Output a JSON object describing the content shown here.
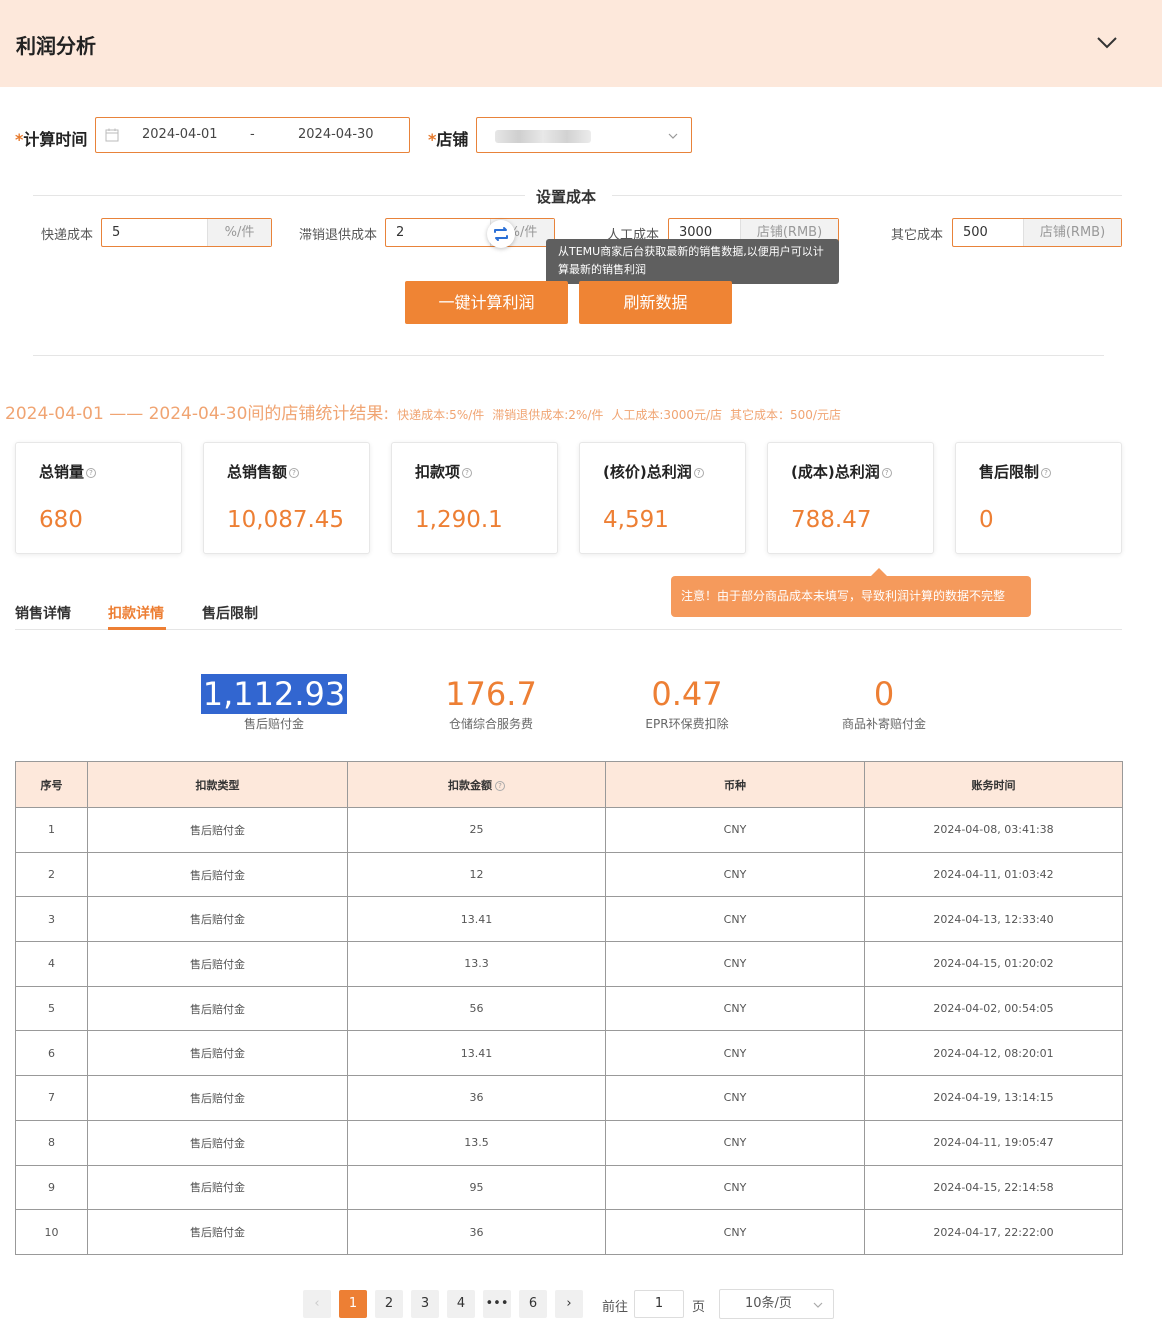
{
  "header": {
    "title": "利润分析"
  },
  "filters": {
    "time_label": "计算时间",
    "required_mark": "*",
    "date_start": "2024-04-01",
    "date_sep": "-",
    "date_end": "2024-04-30",
    "shop_label": "店铺"
  },
  "cost_settings": {
    "title": "设置成本",
    "express": {
      "label": "快递成本",
      "value": "5",
      "unit": "%/件"
    },
    "unsold": {
      "label": "滞销退供成本",
      "value": "2",
      "unit": "%/件"
    },
    "labor": {
      "label": "人工成本",
      "value": "3000",
      "unit": "店铺(RMB)"
    },
    "other": {
      "label": "其它成本",
      "value": "500",
      "unit": "店铺(RMB)"
    }
  },
  "tooltip": {
    "text": "从TEMU商家后台获取最新的销售数据,以便用户可以计算最新的销售利润"
  },
  "buttons": {
    "calc": "一键计算利润",
    "refresh": "刷新数据"
  },
  "summary": {
    "headline": "2024-04-01 —— 2024-04-30间的店铺统计结果:",
    "express": "快递成本:5%/件",
    "unsold": "滞销退供成本:2%/件",
    "labor": "人工成本:3000元/店",
    "other": "其它成本：500/元店"
  },
  "cards": [
    {
      "title": "总销量",
      "value": "680"
    },
    {
      "title": "总销售额",
      "value": "10,087.45"
    },
    {
      "title": "扣款项",
      "value": "1,290.1"
    },
    {
      "title": "(核价)总利润",
      "value": "4,591"
    },
    {
      "title": "(成本)总利润",
      "value": "788.47"
    },
    {
      "title": "售后限制",
      "value": "0"
    }
  ],
  "help_glyph": "?",
  "warning": "注意！由于部分商品成本未填写，导致利润计算的数据不完整",
  "tabs": [
    {
      "label": "销售详情",
      "active": false
    },
    {
      "label": "扣款详情",
      "active": true
    },
    {
      "label": "售后限制",
      "active": false
    }
  ],
  "deduction_stats": [
    {
      "value": "1,112.93",
      "label": "售后赔付金"
    },
    {
      "value": "176.7",
      "label": "仓储综合服务费"
    },
    {
      "value": "0.47",
      "label": "EPR环保费扣除"
    },
    {
      "value": "0",
      "label": "商品补寄赔付金"
    }
  ],
  "table": {
    "headers": [
      "序号",
      "扣款类型",
      "扣款金额",
      "币种",
      "账务时间"
    ],
    "rows": [
      [
        "1",
        "售后赔付金",
        "25",
        "CNY",
        "2024-04-08, 03:41:38"
      ],
      [
        "2",
        "售后赔付金",
        "12",
        "CNY",
        "2024-04-11, 01:03:42"
      ],
      [
        "3",
        "售后赔付金",
        "13.41",
        "CNY",
        "2024-04-13, 12:33:40"
      ],
      [
        "4",
        "售后赔付金",
        "13.3",
        "CNY",
        "2024-04-15, 01:20:02"
      ],
      [
        "5",
        "售后赔付金",
        "56",
        "CNY",
        "2024-04-02, 00:54:05"
      ],
      [
        "6",
        "售后赔付金",
        "13.41",
        "CNY",
        "2024-04-12, 08:20:01"
      ],
      [
        "7",
        "售后赔付金",
        "36",
        "CNY",
        "2024-04-19, 13:14:15"
      ],
      [
        "8",
        "售后赔付金",
        "13.5",
        "CNY",
        "2024-04-11, 19:05:47"
      ],
      [
        "9",
        "售后赔付金",
        "95",
        "CNY",
        "2024-04-15, 22:14:58"
      ],
      [
        "10",
        "售后赔付金",
        "36",
        "CNY",
        "2024-04-17, 22:22:00"
      ]
    ]
  },
  "pagination": {
    "prev": "‹",
    "pages": [
      "1",
      "2",
      "3",
      "4",
      "•••",
      "6"
    ],
    "next": "›",
    "goto_label": "前往",
    "goto_value": "1",
    "page_suffix": "页",
    "page_size": "10条/页"
  },
  "colors": {
    "accent": "#ed7f34",
    "header_bg": "#fde8db",
    "selection": "#3266d0"
  }
}
